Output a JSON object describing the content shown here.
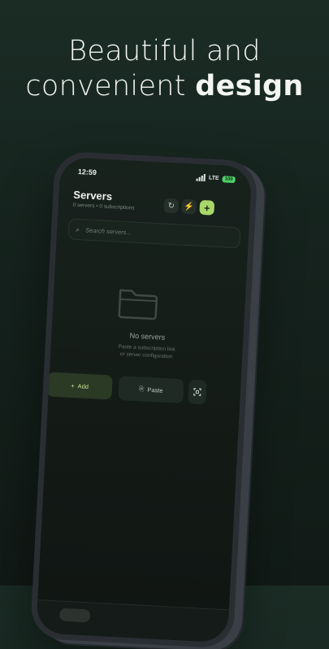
{
  "headline": {
    "line1": "Beautiful and",
    "line2_prefix": "convenient",
    "line2_bold": "design"
  },
  "status_bar": {
    "time": "12:59",
    "network": "LTE",
    "battery": "100"
  },
  "header": {
    "title": "Servers",
    "subtitle": "0 servers • 0 subscriptions",
    "buttons": [
      {
        "icon": "refresh-icon"
      },
      {
        "icon": "bolt-icon"
      },
      {
        "icon": "plus-icon"
      }
    ]
  },
  "search": {
    "placeholder": "Search servers..."
  },
  "empty_state": {
    "icon": "folder-icon",
    "title": "No servers",
    "hint_line1": "Paste a subscription link",
    "hint_line2": "or server configuration"
  },
  "actions": {
    "add_label": "Add",
    "paste_label": "Paste",
    "scan_icon": "scan-icon"
  },
  "colors": {
    "accent": "#a9d86a",
    "background": "#1b2c25",
    "phone_frame": "#2a2e33"
  }
}
